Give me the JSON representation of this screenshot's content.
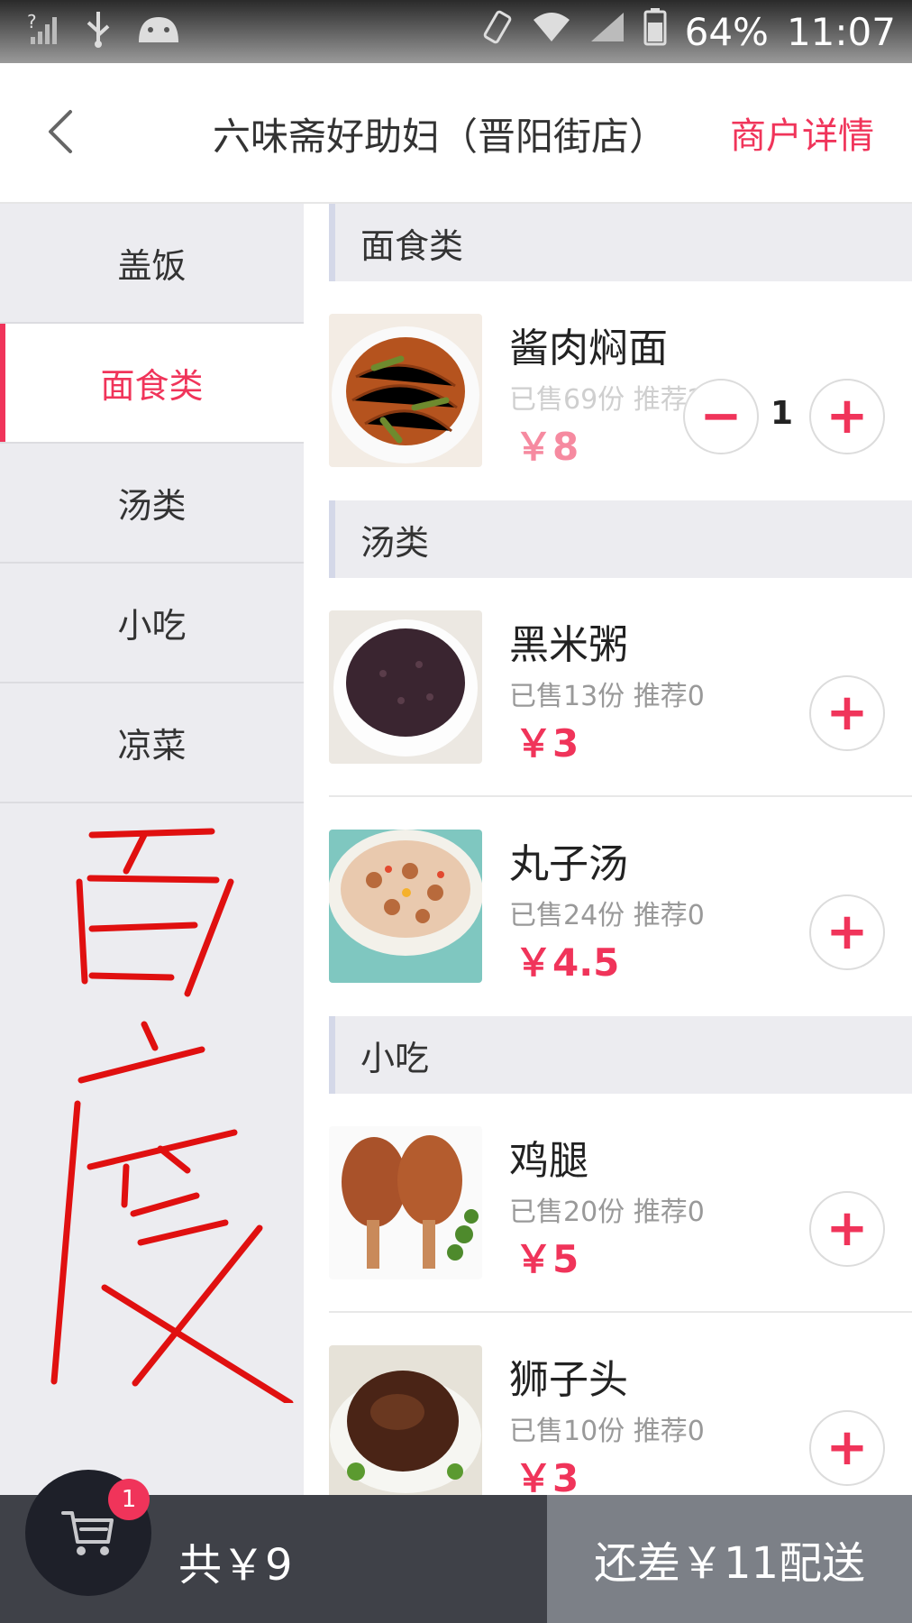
{
  "status_bar": {
    "battery": "64%",
    "time": "11:07",
    "icons": [
      "signal-unknown-icon",
      "usb-icon",
      "android-icon",
      "vibrate-icon",
      "wifi-icon",
      "cell-signal-icon",
      "battery-icon"
    ]
  },
  "header": {
    "title": "六味斋好助妇（晋阳街店）",
    "merchant_link": "商户详情"
  },
  "categories": [
    {
      "label": "盖饭"
    },
    {
      "label": "面食类"
    },
    {
      "label": "汤类"
    },
    {
      "label": "小吃"
    },
    {
      "label": "凉菜"
    }
  ],
  "active_category": "面食类",
  "sections": [
    {
      "title": "面食类",
      "items": [
        {
          "name": "酱肉焖面",
          "sales": "已售69份 推荐2",
          "price": "￥8",
          "quantity": "1"
        }
      ]
    },
    {
      "title": "汤类",
      "items": [
        {
          "name": "黑米粥",
          "sales": "已售13份 推荐0",
          "price": "￥3"
        },
        {
          "name": "丸子汤",
          "sales": "已售24份 推荐0",
          "price": "￥4.5"
        }
      ]
    },
    {
      "title": "小吃",
      "items": [
        {
          "name": "鸡腿",
          "sales": "已售20份 推荐0",
          "price": "￥5"
        },
        {
          "name": "狮子头",
          "sales": "已售10份 推荐0",
          "price": "￥3"
        }
      ]
    }
  ],
  "cart": {
    "badge_count": "1",
    "total": "共￥9",
    "checkout": "还差￥11配送"
  },
  "colors": {
    "accent": "#f0345a",
    "bottom_bar": "#3f4148",
    "checkout_bg": "#7c8087"
  }
}
